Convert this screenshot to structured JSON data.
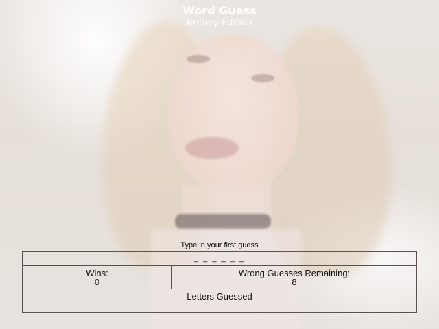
{
  "header": {
    "title": "Word Guess",
    "subtitle": "Britney Edition"
  },
  "game": {
    "prompt": "Type in your first guess",
    "word_display": "_ _ _ _ _ _",
    "wins_label": "Wins:",
    "wins_value": "0",
    "remaining_label": "Wrong Guesses Remaining:",
    "remaining_value": "8",
    "letters_guessed_label": "Letters Guessed",
    "letters_guessed_value": ""
  },
  "background": {
    "description_icon": "portrait-photo"
  }
}
